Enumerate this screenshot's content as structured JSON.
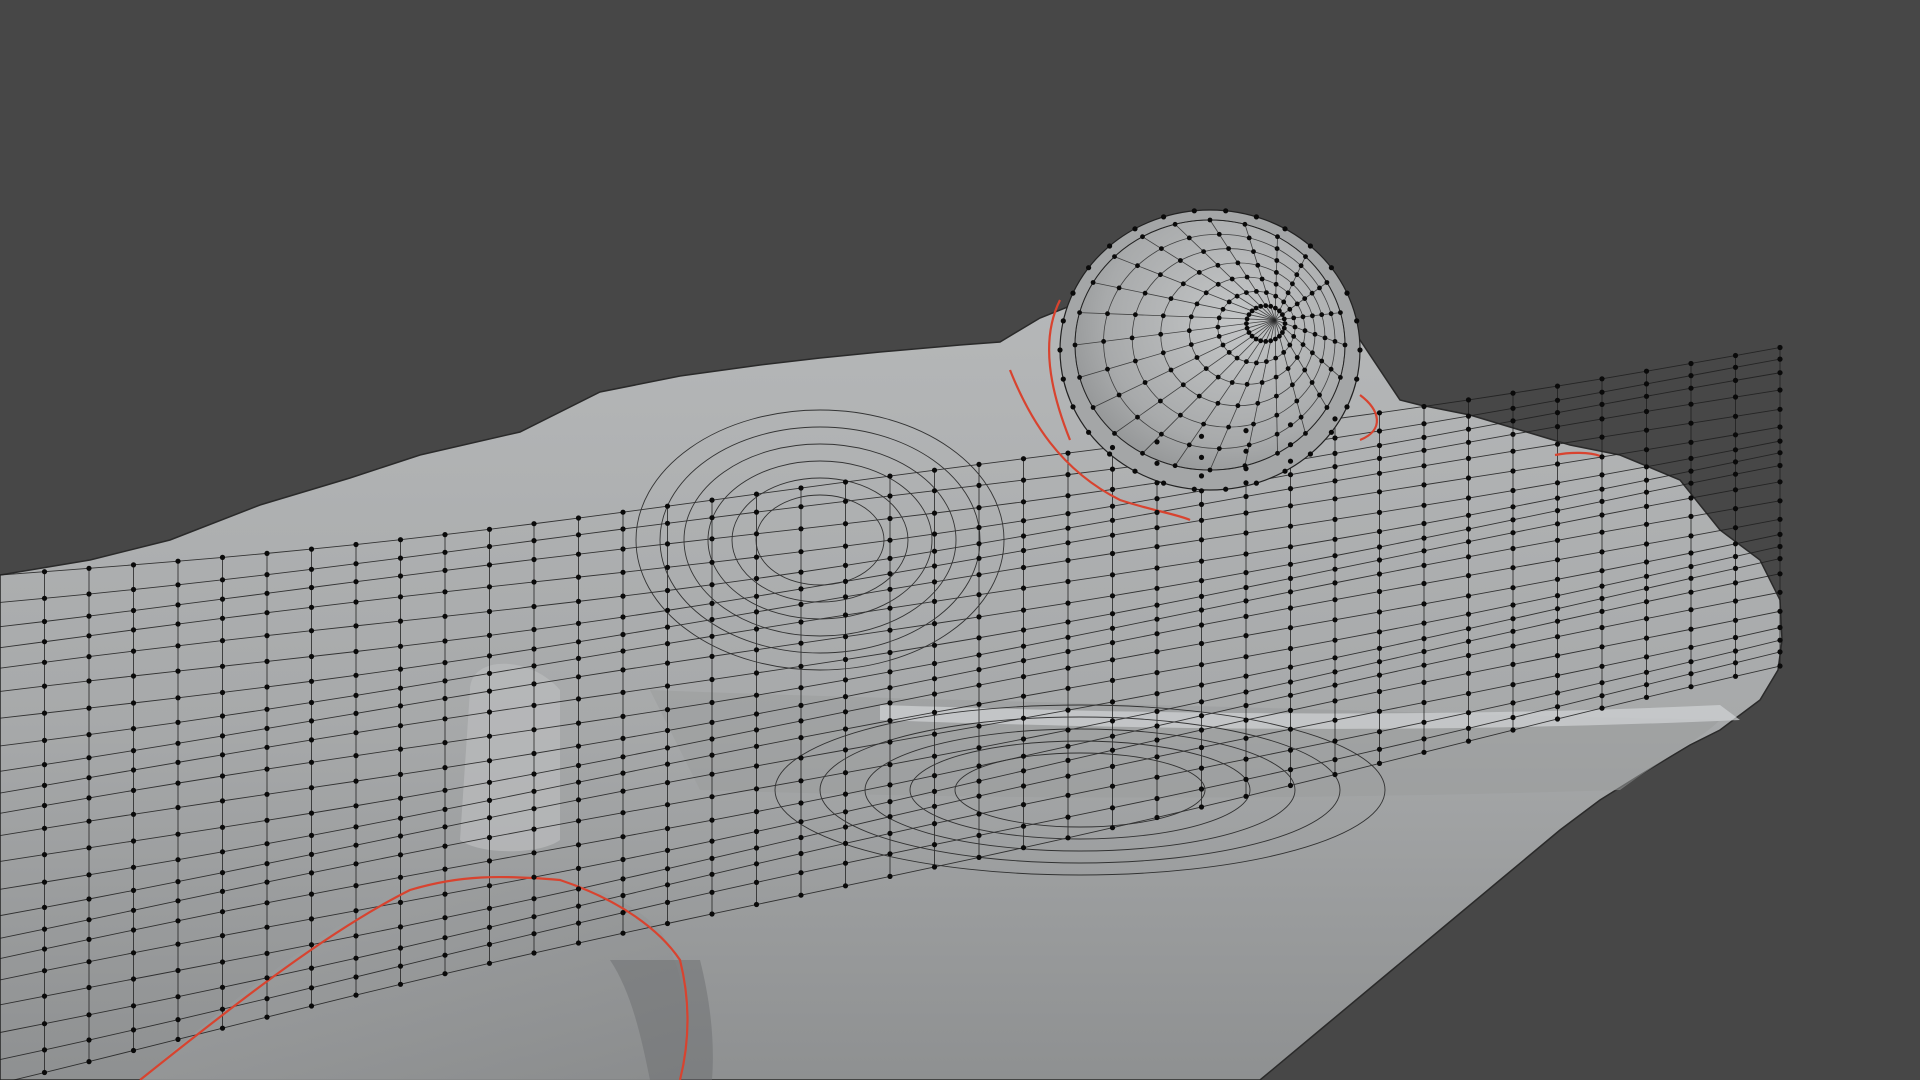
{
  "viewport": {
    "mode": "edit-mode-wireframe-overlay",
    "background_color": "#474747",
    "mesh_color": "#a9abac",
    "edge_color": "#1e1e1e",
    "vertex_color": "#0a0a0a",
    "seam_color": "#d8432f",
    "subject": "frog-head-mesh"
  }
}
